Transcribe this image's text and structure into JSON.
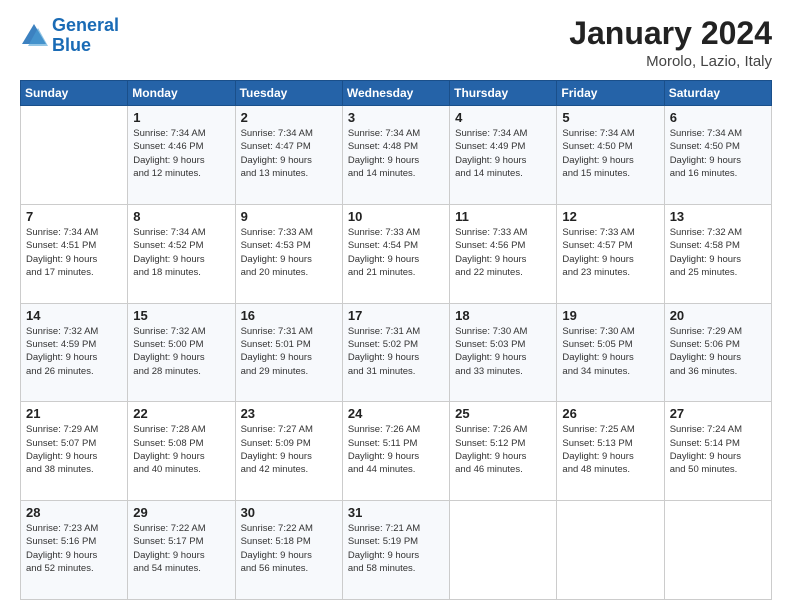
{
  "logo": {
    "line1": "General",
    "line2": "Blue"
  },
  "title": "January 2024",
  "location": "Morolo, Lazio, Italy",
  "days_header": [
    "Sunday",
    "Monday",
    "Tuesday",
    "Wednesday",
    "Thursday",
    "Friday",
    "Saturday"
  ],
  "weeks": [
    [
      {
        "day": "",
        "info": ""
      },
      {
        "day": "1",
        "info": "Sunrise: 7:34 AM\nSunset: 4:46 PM\nDaylight: 9 hours\nand 12 minutes."
      },
      {
        "day": "2",
        "info": "Sunrise: 7:34 AM\nSunset: 4:47 PM\nDaylight: 9 hours\nand 13 minutes."
      },
      {
        "day": "3",
        "info": "Sunrise: 7:34 AM\nSunset: 4:48 PM\nDaylight: 9 hours\nand 14 minutes."
      },
      {
        "day": "4",
        "info": "Sunrise: 7:34 AM\nSunset: 4:49 PM\nDaylight: 9 hours\nand 14 minutes."
      },
      {
        "day": "5",
        "info": "Sunrise: 7:34 AM\nSunset: 4:50 PM\nDaylight: 9 hours\nand 15 minutes."
      },
      {
        "day": "6",
        "info": "Sunrise: 7:34 AM\nSunset: 4:50 PM\nDaylight: 9 hours\nand 16 minutes."
      }
    ],
    [
      {
        "day": "7",
        "info": "Sunrise: 7:34 AM\nSunset: 4:51 PM\nDaylight: 9 hours\nand 17 minutes."
      },
      {
        "day": "8",
        "info": "Sunrise: 7:34 AM\nSunset: 4:52 PM\nDaylight: 9 hours\nand 18 minutes."
      },
      {
        "day": "9",
        "info": "Sunrise: 7:33 AM\nSunset: 4:53 PM\nDaylight: 9 hours\nand 20 minutes."
      },
      {
        "day": "10",
        "info": "Sunrise: 7:33 AM\nSunset: 4:54 PM\nDaylight: 9 hours\nand 21 minutes."
      },
      {
        "day": "11",
        "info": "Sunrise: 7:33 AM\nSunset: 4:56 PM\nDaylight: 9 hours\nand 22 minutes."
      },
      {
        "day": "12",
        "info": "Sunrise: 7:33 AM\nSunset: 4:57 PM\nDaylight: 9 hours\nand 23 minutes."
      },
      {
        "day": "13",
        "info": "Sunrise: 7:32 AM\nSunset: 4:58 PM\nDaylight: 9 hours\nand 25 minutes."
      }
    ],
    [
      {
        "day": "14",
        "info": "Sunrise: 7:32 AM\nSunset: 4:59 PM\nDaylight: 9 hours\nand 26 minutes."
      },
      {
        "day": "15",
        "info": "Sunrise: 7:32 AM\nSunset: 5:00 PM\nDaylight: 9 hours\nand 28 minutes."
      },
      {
        "day": "16",
        "info": "Sunrise: 7:31 AM\nSunset: 5:01 PM\nDaylight: 9 hours\nand 29 minutes."
      },
      {
        "day": "17",
        "info": "Sunrise: 7:31 AM\nSunset: 5:02 PM\nDaylight: 9 hours\nand 31 minutes."
      },
      {
        "day": "18",
        "info": "Sunrise: 7:30 AM\nSunset: 5:03 PM\nDaylight: 9 hours\nand 33 minutes."
      },
      {
        "day": "19",
        "info": "Sunrise: 7:30 AM\nSunset: 5:05 PM\nDaylight: 9 hours\nand 34 minutes."
      },
      {
        "day": "20",
        "info": "Sunrise: 7:29 AM\nSunset: 5:06 PM\nDaylight: 9 hours\nand 36 minutes."
      }
    ],
    [
      {
        "day": "21",
        "info": "Sunrise: 7:29 AM\nSunset: 5:07 PM\nDaylight: 9 hours\nand 38 minutes."
      },
      {
        "day": "22",
        "info": "Sunrise: 7:28 AM\nSunset: 5:08 PM\nDaylight: 9 hours\nand 40 minutes."
      },
      {
        "day": "23",
        "info": "Sunrise: 7:27 AM\nSunset: 5:09 PM\nDaylight: 9 hours\nand 42 minutes."
      },
      {
        "day": "24",
        "info": "Sunrise: 7:26 AM\nSunset: 5:11 PM\nDaylight: 9 hours\nand 44 minutes."
      },
      {
        "day": "25",
        "info": "Sunrise: 7:26 AM\nSunset: 5:12 PM\nDaylight: 9 hours\nand 46 minutes."
      },
      {
        "day": "26",
        "info": "Sunrise: 7:25 AM\nSunset: 5:13 PM\nDaylight: 9 hours\nand 48 minutes."
      },
      {
        "day": "27",
        "info": "Sunrise: 7:24 AM\nSunset: 5:14 PM\nDaylight: 9 hours\nand 50 minutes."
      }
    ],
    [
      {
        "day": "28",
        "info": "Sunrise: 7:23 AM\nSunset: 5:16 PM\nDaylight: 9 hours\nand 52 minutes."
      },
      {
        "day": "29",
        "info": "Sunrise: 7:22 AM\nSunset: 5:17 PM\nDaylight: 9 hours\nand 54 minutes."
      },
      {
        "day": "30",
        "info": "Sunrise: 7:22 AM\nSunset: 5:18 PM\nDaylight: 9 hours\nand 56 minutes."
      },
      {
        "day": "31",
        "info": "Sunrise: 7:21 AM\nSunset: 5:19 PM\nDaylight: 9 hours\nand 58 minutes."
      },
      {
        "day": "",
        "info": ""
      },
      {
        "day": "",
        "info": ""
      },
      {
        "day": "",
        "info": ""
      }
    ]
  ]
}
